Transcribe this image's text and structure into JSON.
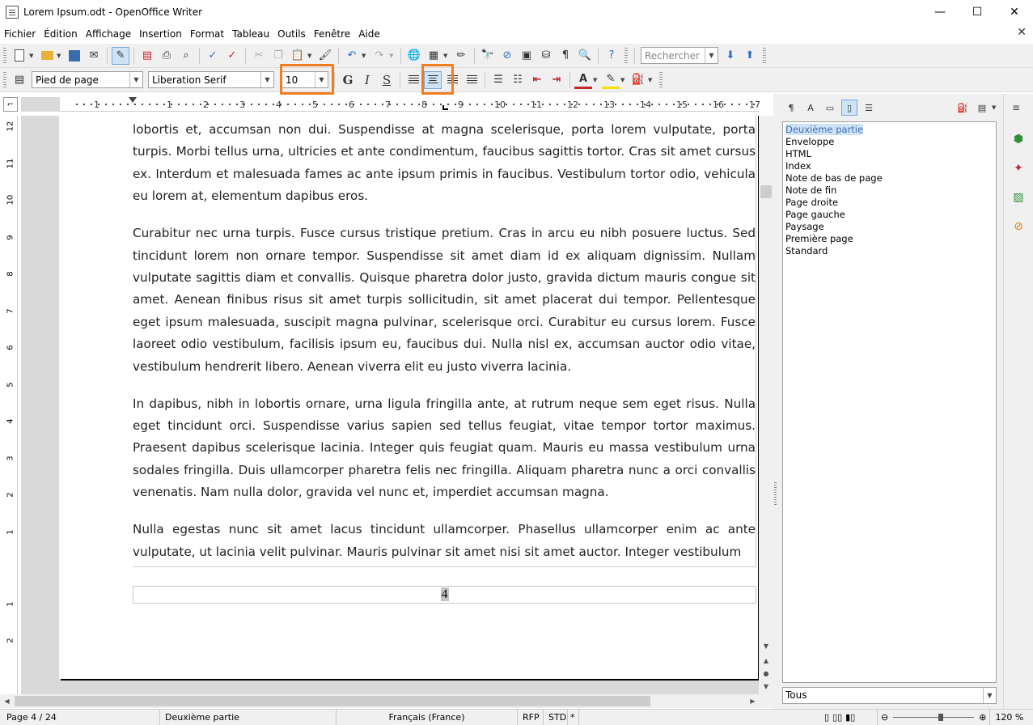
{
  "window": {
    "title": "Lorem Ipsum.odt - OpenOffice Writer",
    "minimize": "—",
    "maximize": "☐",
    "close": "✕",
    "doc_close": "✕"
  },
  "menu": [
    "Fichier",
    "Édition",
    "Affichage",
    "Insertion",
    "Format",
    "Tableau",
    "Outils",
    "Fenêtre",
    "Aide"
  ],
  "toolbar_standard": {
    "search_placeholder": "Rechercher"
  },
  "toolbar_format": {
    "paragraph_style": "Pied de page",
    "font_name": "Liberation Serif",
    "font_size": "10",
    "bold_label": "G",
    "italic_label": "I",
    "underline_label": "S"
  },
  "ruler": {
    "numbers": [
      "1",
      "1",
      "2",
      "3",
      "4",
      "5",
      "6",
      "7",
      "8",
      "9",
      "10",
      "11",
      "12",
      "13",
      "14",
      "15",
      "16",
      "17"
    ],
    "vertical_numbers": [
      "12",
      "11",
      "10",
      "9",
      "8",
      "7",
      "6",
      "5",
      "4",
      "3",
      "2",
      "1",
      "1",
      "2"
    ]
  },
  "document": {
    "paragraphs": [
      "lobortis et, accumsan non dui. Suspendisse at magna scelerisque, porta lorem vulputate, porta turpis. Morbi tellus urna, ultricies et ante condimentum, faucibus sagittis tortor. Cras sit amet cursus ex. Interdum et malesuada fames ac ante ipsum primis in faucibus. Vestibulum tortor odio, vehicula eu lorem at, elementum dapibus eros.",
      "Curabitur nec urna turpis. Fusce cursus tristique pretium. Cras in arcu eu nibh posuere luctus. Sed tincidunt lorem non ornare tempor. Suspendisse sit amet diam id ex aliquam dignissim. Nullam vulputate sagittis diam et convallis. Quisque pharetra dolor justo, gravida dictum mauris congue sit amet. Aenean finibus risus sit amet turpis sollicitudin, sit amet placerat dui tempor. Pellentesque eget ipsum malesuada, suscipit magna pulvinar, scelerisque orci. Curabitur eu cursus lorem. Fusce laoreet odio vestibulum, facilisis ipsum eu, faucibus dui. Nulla nisl ex, accumsan auctor odio vitae, vestibulum hendrerit libero. Aenean viverra elit eu justo viverra lacinia.",
      "In dapibus, nibh in lobortis ornare, urna ligula fringilla ante, at rutrum neque sem eget risus. Nulla eget tincidunt orci. Suspendisse varius sapien sed tellus feugiat, vitae tempor tortor maximus. Praesent dapibus scelerisque lacinia. Integer quis feugiat quam. Mauris eu massa vestibulum urna sodales fringilla. Duis ullamcorper pharetra felis nec fringilla. Aliquam pharetra nunc a orci convallis venenatis. Nam nulla dolor, gravida vel nunc et, imperdiet accumsan magna.",
      "Nulla egestas nunc sit amet lacus tincidunt ullamcorper. Phasellus ullamcorper enim ac ante vulputate, ut lacinia velit pulvinar. Mauris pulvinar sit amet nisi sit amet auctor. Integer vestibulum"
    ],
    "footer_page_number": "4"
  },
  "styles_panel": {
    "items": [
      "Deuxième partie",
      "Enveloppe",
      "HTML",
      "Index",
      "Note de bas de page",
      "Note de fin",
      "Page droite",
      "Page gauche",
      "Paysage",
      "Première page",
      "Standard"
    ],
    "selected_index": 0,
    "filter": "Tous"
  },
  "statusbar": {
    "page": "Page 4 / 24",
    "page_style": "Deuxième partie",
    "language": "Français (France)",
    "mode1": "RFP",
    "mode2": "STD",
    "modified": "*",
    "zoom": "120 %"
  },
  "colors": {
    "highlight_box": "#ef7d22",
    "selection": "#cfe3f7"
  }
}
